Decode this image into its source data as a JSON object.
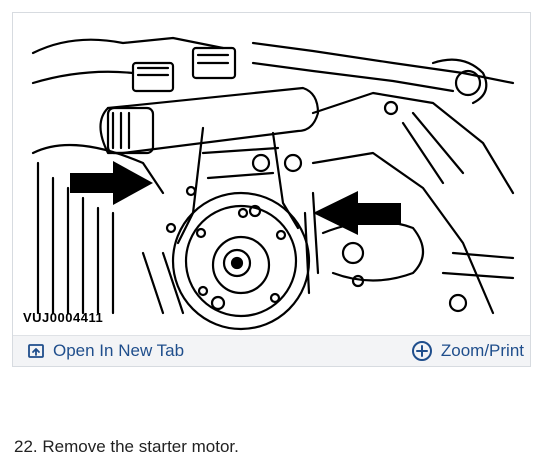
{
  "figure": {
    "id_label": "VUJ0004411",
    "open_tab_label": "Open In New Tab",
    "zoom_print_label": "Zoom/Print",
    "open_tab_icon": "open-in-new-tab-icon",
    "zoom_icon": "plus-circle-icon"
  },
  "step": {
    "text": "22. Remove the starter motor."
  },
  "colors": {
    "link": "#1f4e8c",
    "toolbar_bg": "#f3f4f6"
  }
}
